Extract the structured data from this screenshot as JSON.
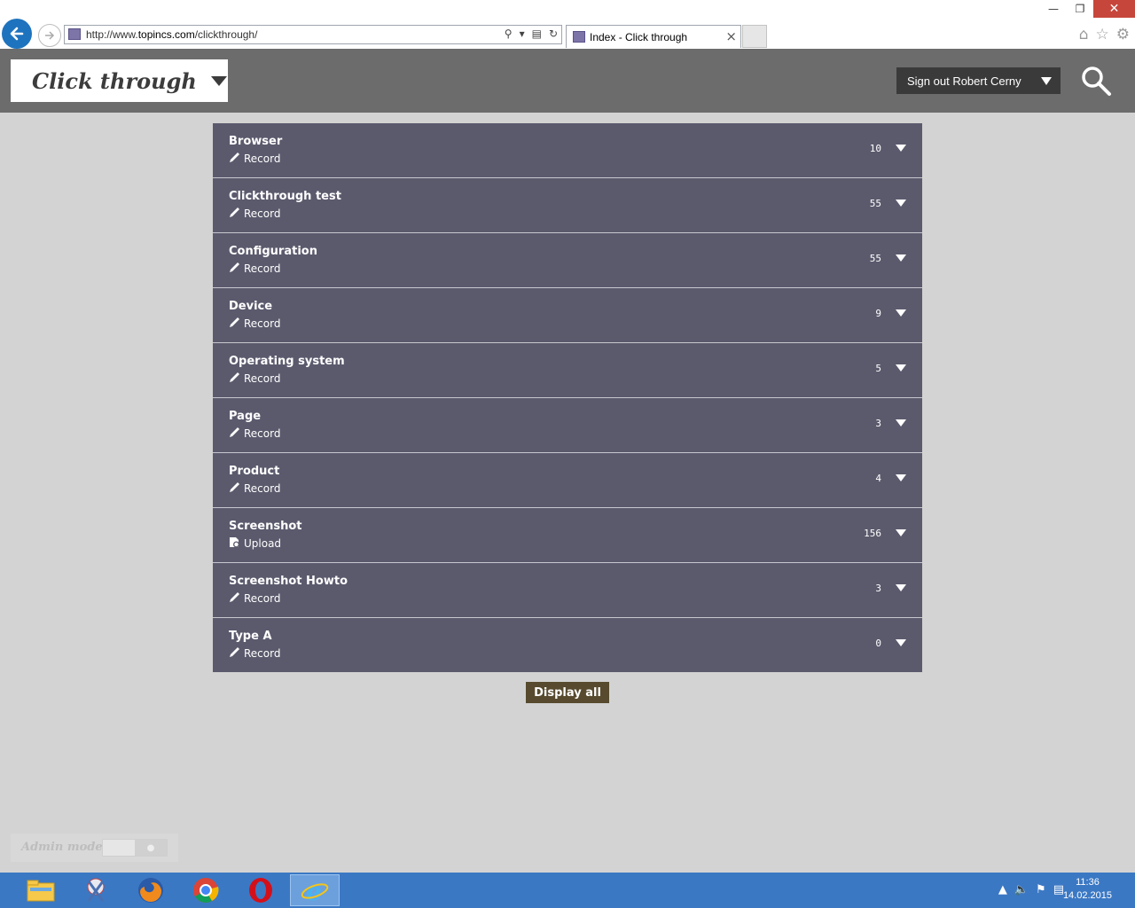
{
  "browser": {
    "url_prefix": "http://www.",
    "url_host": "topincs.com",
    "url_path": "/clickthrough/",
    "tab_title": "Index - Click through",
    "tab_close": "×"
  },
  "header": {
    "app_title": "Click through",
    "signout_label": "Sign out Robert Cerny"
  },
  "rows": [
    {
      "name": "Browser",
      "action": "Record",
      "icon": "pencil-icon",
      "count": "10"
    },
    {
      "name": "Clickthrough test",
      "action": "Record",
      "icon": "pencil-icon",
      "count": "55"
    },
    {
      "name": "Configuration",
      "action": "Record",
      "icon": "pencil-icon",
      "count": "55"
    },
    {
      "name": "Device",
      "action": "Record",
      "icon": "pencil-icon",
      "count": "9"
    },
    {
      "name": "Operating system",
      "action": "Record",
      "icon": "pencil-icon",
      "count": "5"
    },
    {
      "name": "Page",
      "action": "Record",
      "icon": "pencil-icon",
      "count": "3"
    },
    {
      "name": "Product",
      "action": "Record",
      "icon": "pencil-icon",
      "count": "4"
    },
    {
      "name": "Screenshot",
      "action": "Upload",
      "icon": "upload-icon",
      "count": "156"
    },
    {
      "name": "Screenshot Howto",
      "action": "Record",
      "icon": "pencil-icon",
      "count": "3"
    },
    {
      "name": "Type A",
      "action": "Record",
      "icon": "pencil-icon",
      "count": "0"
    }
  ],
  "display_all_label": "Display all",
  "admin_mode_label": "Admin mode",
  "taskbar": {
    "time": "11:36",
    "date": "14.02.2015"
  },
  "colors": {
    "row_bg": "#5b5a6d",
    "header_bg": "#6c6c6c",
    "display_all_bg": "#574a2e",
    "taskbar_bg": "#3b78c4"
  }
}
